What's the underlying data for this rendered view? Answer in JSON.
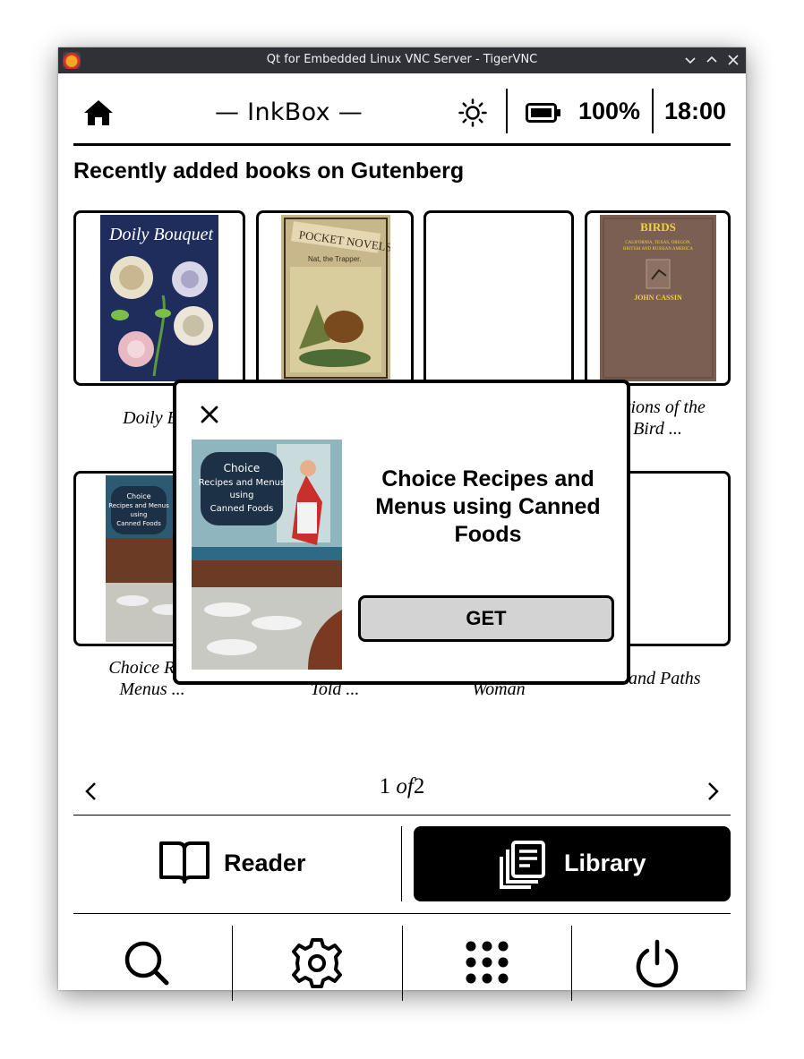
{
  "window": {
    "title": "Qt for Embedded Linux VNC Server - TigerVNC",
    "minimize_glyph": "⌄",
    "maximize_glyph": "⌃",
    "close_glyph": "✕"
  },
  "header": {
    "title": "— InkBox —",
    "battery": "100%",
    "time": "18:00",
    "icons": [
      "home-icon",
      "brightness-icon",
      "battery-icon"
    ]
  },
  "section_title": "Recently added books on Gutenberg",
  "books": [
    {
      "title": "Doily Bou",
      "cover_text": "Doily Bouquet",
      "cover_color": "#1f2d5c"
    },
    {
      "title": "",
      "cover_text": "POCKET NOVELS",
      "cover_subtext": "Nat, the Trapper.",
      "cover_color": "#c8b78a"
    },
    {
      "title": "",
      "cover_text": "",
      "cover_color": "#ffffff"
    },
    {
      "title_line1": "rations of the",
      "title_line2": "Bird ...",
      "cover_text": "BIRDS",
      "cover_subtext": "CALIFORNIA, TEXAS, OREGON, BRITISH AND RUSSIAN AMERICA",
      "cover_author": "JOHN CASSIN",
      "cover_color": "#7a5f52"
    },
    {
      "title_line1": "Choice Reci",
      "title_line2": "Menus  ...",
      "cover_text": "Choice Recipes and Menus using Canned Foods",
      "cover_color": "#2c5a72"
    },
    {
      "title": "Told ..."
    },
    {
      "title": "Woman"
    },
    {
      "title": "dland Paths"
    }
  ],
  "pager": {
    "current": "1",
    "of": "of",
    "total": "2"
  },
  "nav": {
    "reader_label": "Reader",
    "library_label": "Library"
  },
  "bottom_icons": [
    "search-icon",
    "settings-icon",
    "apps-grid-icon",
    "power-icon"
  ],
  "popup": {
    "title": "Choice Recipes and Menus using Canned Foods",
    "cover_text": "Choice Recipes and Menus using Canned Foods",
    "get_label": "GET"
  },
  "colors": {
    "accent": "#000000",
    "get_button_bg": "#d3d3d3",
    "titlebar_bg": "#2f3136"
  }
}
